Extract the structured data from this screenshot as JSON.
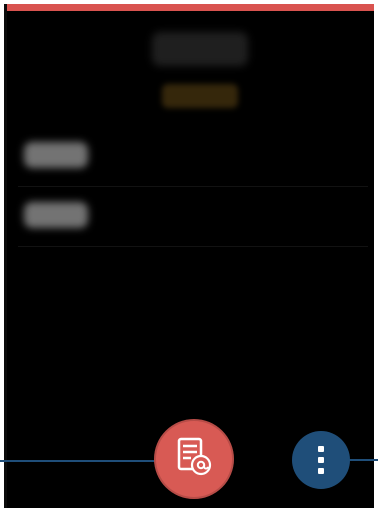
{
  "screen": {
    "title": "",
    "subtitle": "",
    "rows": [
      {
        "label": ""
      },
      {
        "label": ""
      }
    ]
  },
  "actions": {
    "email_button_icon": "document-email-icon",
    "more_button_icon": "more-vertical-icon"
  },
  "colors": {
    "background": "#000000",
    "top_accent": "#d9534f",
    "email_fab": "#d85a54",
    "more_fab": "#1f4e79",
    "callout_line": "#1f4e79",
    "subtitle_text": "#d39a2c"
  }
}
